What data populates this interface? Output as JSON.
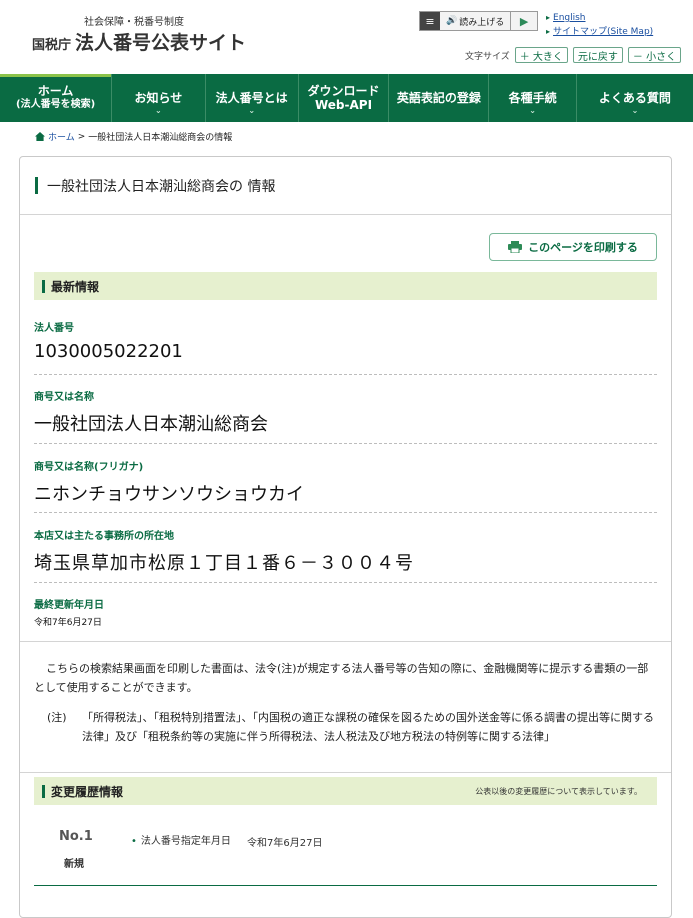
{
  "header": {
    "logo_sub": "社会保障・税番号制度",
    "logo_agency": "国税庁",
    "logo_main": "法人番号公表サイト",
    "speech_label": "読み上げる",
    "links": [
      "English",
      "サイトマップ(Site Map)"
    ],
    "font_size_label": "文字サイズ",
    "font_buttons": [
      "＋ 大きく",
      "元に戻す",
      "－ 小さく"
    ]
  },
  "nav": {
    "items": [
      {
        "line1": "ホーム",
        "line2": "(法人番号を検索)"
      },
      {
        "line1": "お知らせ",
        "line2": ""
      },
      {
        "line1": "法人番号とは",
        "line2": ""
      },
      {
        "line1": "ダウンロード",
        "line2": "Web-API"
      },
      {
        "line1": "英語表記の登録",
        "line2": ""
      },
      {
        "line1": "各種手続",
        "line2": ""
      },
      {
        "line1": "よくある質問",
        "line2": ""
      }
    ]
  },
  "breadcrumb": {
    "home": "ホーム",
    "separator": ">",
    "current": "一般社団法人日本潮汕総商会の情報"
  },
  "page": {
    "title": "一般社団法人日本潮汕総商会の 情報",
    "print_label": "このページを印刷する"
  },
  "latest": {
    "section_label": "最新情報",
    "corp_number_label": "法人番号",
    "corp_number": "1030005022201",
    "name_label": "商号又は名称",
    "name": "一般社団法人日本潮汕総商会",
    "furigana_label": "商号又は名称(フリガナ)",
    "furigana": "ニホンチョウサンソウショウカイ",
    "address_label": "本店又は主たる事務所の所在地",
    "address": "埼玉県草加市松原１丁目１番６－３００４号",
    "updated_label": "最終更新年月日",
    "updated": "令和7年6月27日"
  },
  "notice": {
    "paragraph": "こちらの検索結果画面を印刷した書面は、法令(注)が規定する法人番号等の告知の際に、金融機関等に提示する書類の一部として使用することができます。",
    "note_mark": "(注)",
    "note_text": "「所得税法」、「租税特別措置法」、「内国税の適正な課税の確保を図るための国外送金等に係る調書の提出等に関する法律」及び「租税条約等の実施に伴う所得税法、法人税法及び地方税法の特例等に関する法律」"
  },
  "history": {
    "section_label": "変更履歴情報",
    "section_note": "公表以後の変更履歴について表示しています。",
    "entries": [
      {
        "no": "No.1",
        "kind": "新規",
        "item": "法人番号指定年月日",
        "date": "令和7年6月27日"
      }
    ]
  },
  "colors": {
    "brand_green": "#0a6b43",
    "section_bg": "#e6f0cf"
  }
}
